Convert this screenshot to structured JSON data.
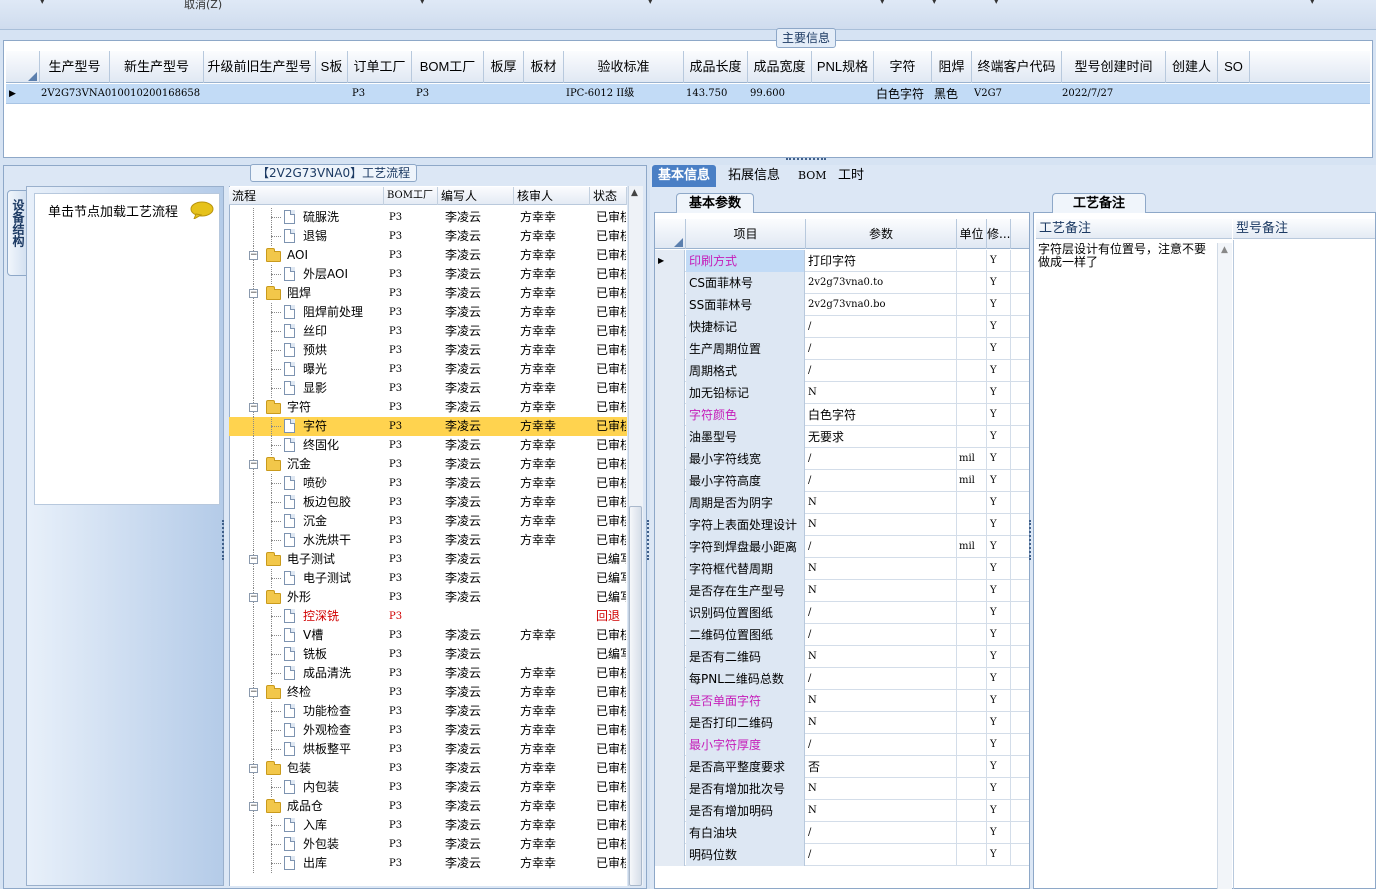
{
  "topbar": {
    "cancel_label": "取消(Z)"
  },
  "main_info": {
    "legend": "主要信息",
    "columns": [
      "生产型号",
      "新生产型号",
      "升级前旧生产型号",
      "S板",
      "订单工厂",
      "BOM工厂",
      "板厚",
      "板材",
      "验收标准",
      "成品长度",
      "成品宽度",
      "PNL规格",
      "字符",
      "阻焊",
      "终端客户代码",
      "型号创建时间",
      "创建人",
      "SO"
    ],
    "row": {
      "prod_model": "2V2G73VNA0",
      "new_model": "10010200168658",
      "order_factory": "P3",
      "bom_factory": "P3",
      "standard": "IPC-6012 II级",
      "length": "143.750",
      "width": "99.600",
      "char": "白色字符",
      "mask": "黑色",
      "customer": "V2G7",
      "created": "2022/7/27"
    }
  },
  "left_panel": {
    "vertical_tab": "设备结构",
    "hint": "单击节点加载工艺流程",
    "tree_title": "【2V2G73VNA0】工艺流程",
    "tree_columns": [
      "流程",
      "BOM工厂",
      "编写人",
      "核审人",
      "状态"
    ],
    "rows": [
      {
        "name": "硫脲洗",
        "bom": "P3",
        "writer": "李凌云",
        "reviewer": "方幸幸",
        "status": "已审核"
      },
      {
        "name": "退锡",
        "bom": "P3",
        "writer": "李凌云",
        "reviewer": "方幸幸",
        "status": "已审核"
      },
      {
        "name": "AOI",
        "bom": "P3",
        "writer": "李凌云",
        "reviewer": "方幸幸",
        "status": "已审核"
      },
      {
        "name": "外层AOI",
        "bom": "P3",
        "writer": "李凌云",
        "reviewer": "方幸幸",
        "status": "已审核"
      },
      {
        "name": "阻焊",
        "bom": "P3",
        "writer": "李凌云",
        "reviewer": "方幸幸",
        "status": "已审核"
      },
      {
        "name": "阻焊前处理",
        "bom": "P3",
        "writer": "李凌云",
        "reviewer": "方幸幸",
        "status": "已审核"
      },
      {
        "name": "丝印",
        "bom": "P3",
        "writer": "李凌云",
        "reviewer": "方幸幸",
        "status": "已审核"
      },
      {
        "name": "预烘",
        "bom": "P3",
        "writer": "李凌云",
        "reviewer": "方幸幸",
        "status": "已审核"
      },
      {
        "name": "曝光",
        "bom": "P3",
        "writer": "李凌云",
        "reviewer": "方幸幸",
        "status": "已审核"
      },
      {
        "name": "显影",
        "bom": "P3",
        "writer": "李凌云",
        "reviewer": "方幸幸",
        "status": "已审核"
      },
      {
        "name": "字符",
        "bom": "P3",
        "writer": "李凌云",
        "reviewer": "方幸幸",
        "status": "已审核"
      },
      {
        "name": "字符",
        "bom": "P3",
        "writer": "李凌云",
        "reviewer": "方幸幸",
        "status": "已审核"
      },
      {
        "name": "终固化",
        "bom": "P3",
        "writer": "李凌云",
        "reviewer": "方幸幸",
        "status": "已审核"
      },
      {
        "name": "沉金",
        "bom": "P3",
        "writer": "李凌云",
        "reviewer": "方幸幸",
        "status": "已审核"
      },
      {
        "name": "喷砂",
        "bom": "P3",
        "writer": "李凌云",
        "reviewer": "方幸幸",
        "status": "已审核"
      },
      {
        "name": "板边包胶",
        "bom": "P3",
        "writer": "李凌云",
        "reviewer": "方幸幸",
        "status": "已审核"
      },
      {
        "name": "沉金",
        "bom": "P3",
        "writer": "李凌云",
        "reviewer": "方幸幸",
        "status": "已审核"
      },
      {
        "name": "水洗烘干",
        "bom": "P3",
        "writer": "李凌云",
        "reviewer": "方幸幸",
        "status": "已审核"
      },
      {
        "name": "电子测试",
        "bom": "P3",
        "writer": "李凌云",
        "reviewer": "",
        "status": "已编写"
      },
      {
        "name": "电子测试",
        "bom": "P3",
        "writer": "李凌云",
        "reviewer": "",
        "status": "已编写"
      },
      {
        "name": "外形",
        "bom": "P3",
        "writer": "李凌云",
        "reviewer": "",
        "status": "已编写"
      },
      {
        "name": "控深铣",
        "bom": "P3",
        "writer": "",
        "reviewer": "",
        "status": "回退"
      },
      {
        "name": "V槽",
        "bom": "P3",
        "writer": "李凌云",
        "reviewer": "方幸幸",
        "status": "已审核"
      },
      {
        "name": "铣板",
        "bom": "P3",
        "writer": "李凌云",
        "reviewer": "",
        "status": "已编写"
      },
      {
        "name": "成品清洗",
        "bom": "P3",
        "writer": "李凌云",
        "reviewer": "方幸幸",
        "status": "已审核"
      },
      {
        "name": "终检",
        "bom": "P3",
        "writer": "李凌云",
        "reviewer": "方幸幸",
        "status": "已审核"
      },
      {
        "name": "功能检查",
        "bom": "P3",
        "writer": "李凌云",
        "reviewer": "方幸幸",
        "status": "已审核"
      },
      {
        "name": "外观检查",
        "bom": "P3",
        "writer": "李凌云",
        "reviewer": "方幸幸",
        "status": "已审核"
      },
      {
        "name": "烘板整平",
        "bom": "P3",
        "writer": "李凌云",
        "reviewer": "方幸幸",
        "status": "已审核"
      },
      {
        "name": "包装",
        "bom": "P3",
        "writer": "李凌云",
        "reviewer": "方幸幸",
        "status": "已审核"
      },
      {
        "name": "内包装",
        "bom": "P3",
        "writer": "李凌云",
        "reviewer": "方幸幸",
        "status": "已审核"
      },
      {
        "name": "成品仓",
        "bom": "P3",
        "writer": "李凌云",
        "reviewer": "方幸幸",
        "status": "已审核"
      },
      {
        "name": "入库",
        "bom": "P3",
        "writer": "李凌云",
        "reviewer": "方幸幸",
        "status": "已审核"
      },
      {
        "name": "外包装",
        "bom": "P3",
        "writer": "李凌云",
        "reviewer": "方幸幸",
        "status": "已审核"
      },
      {
        "name": "出库",
        "bom": "P3",
        "writer": "李凌云",
        "reviewer": "方幸幸",
        "status": "已审核"
      }
    ]
  },
  "right_panel": {
    "tabs": [
      "基本信息",
      "拓展信息",
      "BOM",
      "工时"
    ],
    "basic_tab": "基本参数",
    "param_columns": [
      "项目",
      "参数",
      "单位",
      "修..."
    ],
    "params": [
      {
        "item": "印刷方式",
        "value": "打印字符",
        "unit": "",
        "mod": "Y"
      },
      {
        "item": "CS面菲林号",
        "value": "2v2g73vna0.to",
        "unit": "",
        "mod": "Y"
      },
      {
        "item": "SS面菲林号",
        "value": "2v2g73vna0.bo",
        "unit": "",
        "mod": "Y"
      },
      {
        "item": "快捷标记",
        "value": "/",
        "unit": "",
        "mod": "Y"
      },
      {
        "item": "生产周期位置",
        "value": "/",
        "unit": "",
        "mod": "Y"
      },
      {
        "item": "周期格式",
        "value": "/",
        "unit": "",
        "mod": "Y"
      },
      {
        "item": "加无铅标记",
        "value": "N",
        "unit": "",
        "mod": "Y"
      },
      {
        "item": "字符颜色",
        "value": "白色字符",
        "unit": "",
        "mod": "Y"
      },
      {
        "item": "油墨型号",
        "value": "无要求",
        "unit": "",
        "mod": "Y"
      },
      {
        "item": "最小字符线宽",
        "value": "/",
        "unit": "mil",
        "mod": "Y"
      },
      {
        "item": "最小字符高度",
        "value": "/",
        "unit": "mil",
        "mod": "Y"
      },
      {
        "item": "周期是否为阴字",
        "value": "N",
        "unit": "",
        "mod": "Y"
      },
      {
        "item": "字符上表面处理设计",
        "value": "N",
        "unit": "",
        "mod": "Y"
      },
      {
        "item": "字符到焊盘最小距离",
        "value": "/",
        "unit": "mil",
        "mod": "Y"
      },
      {
        "item": "字符框代替周期",
        "value": "N",
        "unit": "",
        "mod": "Y"
      },
      {
        "item": "是否存在生产型号",
        "value": "N",
        "unit": "",
        "mod": "Y"
      },
      {
        "item": "识别码位置图纸",
        "value": "/",
        "unit": "",
        "mod": "Y"
      },
      {
        "item": "二维码位置图纸",
        "value": "/",
        "unit": "",
        "mod": "Y"
      },
      {
        "item": "是否有二维码",
        "value": "N",
        "unit": "",
        "mod": "Y"
      },
      {
        "item": "每PNL二维码总数",
        "value": "/",
        "unit": "",
        "mod": "Y"
      },
      {
        "item": "是否单面字符",
        "value": "N",
        "unit": "",
        "mod": "Y"
      },
      {
        "item": "是否打印二维码",
        "value": "N",
        "unit": "",
        "mod": "Y"
      },
      {
        "item": "最小字符厚度",
        "value": "/",
        "unit": "",
        "mod": "Y"
      },
      {
        "item": "是否高平整度要求",
        "value": "否",
        "unit": "",
        "mod": "Y"
      },
      {
        "item": "是否有增加批次号",
        "value": "N",
        "unit": "",
        "mod": "Y"
      },
      {
        "item": "是否有增加明码",
        "value": "N",
        "unit": "",
        "mod": "Y"
      },
      {
        "item": "有白油块",
        "value": "/",
        "unit": "",
        "mod": "Y"
      },
      {
        "item": "明码位数",
        "value": "/",
        "unit": "",
        "mod": "Y"
      }
    ],
    "notes_tab": "工艺备注",
    "notes_col1": "工艺备注",
    "notes_col2": "型号备注",
    "notes_text": "字符层设计有位置号，注意不要做成一样了"
  }
}
